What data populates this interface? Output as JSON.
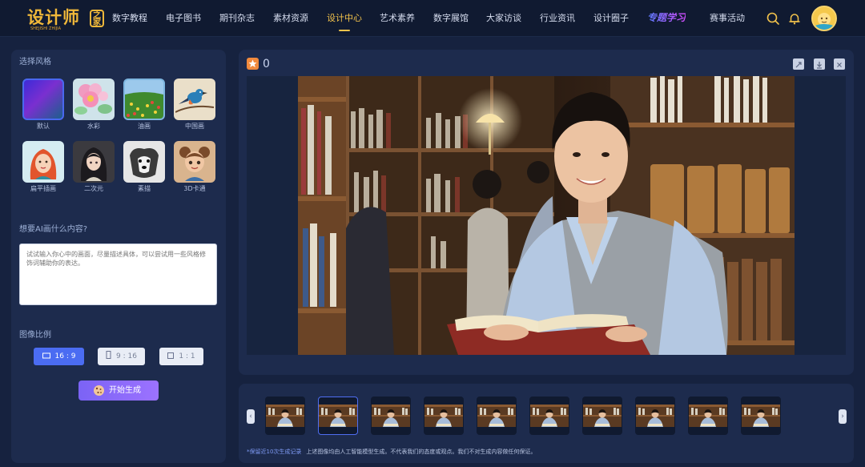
{
  "logo": {
    "text": "设计师",
    "badge": "之家",
    "sub": "SHEJISHI ZHIJIA"
  },
  "nav": {
    "items": [
      {
        "label": "数字教程"
      },
      {
        "label": "电子图书"
      },
      {
        "label": "期刊杂志"
      },
      {
        "label": "素材资源"
      },
      {
        "label": "设计中心",
        "active": true
      },
      {
        "label": "艺术素养"
      },
      {
        "label": "数字展馆"
      },
      {
        "label": "大家访谈"
      },
      {
        "label": "行业资讯"
      },
      {
        "label": "设计圈子"
      },
      {
        "label": "专题学习",
        "special": true
      },
      {
        "label": "赛事活动"
      }
    ],
    "icons": [
      "search-icon",
      "bell-icon"
    ],
    "accent": "#f3c34c"
  },
  "sidebar": {
    "style_title": "选择风格",
    "styles": [
      {
        "label": "默认",
        "selected": true
      },
      {
        "label": "水彩"
      },
      {
        "label": "油画"
      },
      {
        "label": "中国画"
      },
      {
        "label": "扁平插画"
      },
      {
        "label": "二次元"
      },
      {
        "label": "素描"
      },
      {
        "label": "3D卡通"
      }
    ],
    "prompt_title": "想要AI画什么内容?",
    "prompt_placeholder": "试试输入你心中的画面，尽量描述具体，可以尝试用一些风格修饰词辅助你的表达。",
    "ratio_title": "图像比例",
    "ratios": [
      {
        "label": "16 : 9",
        "active": true
      },
      {
        "label": "9 : 16"
      },
      {
        "label": "1 : 1"
      }
    ],
    "generate_label": "开始生成",
    "button_color": "#8a6bf8"
  },
  "main": {
    "favorite_count": "0",
    "tools": [
      "expand-icon",
      "download-icon",
      "close-icon"
    ]
  },
  "history": {
    "thumb_count": 10,
    "selected_index": 1,
    "note_left": "*保留近10次生成记录",
    "note_right": "上述图像均由人工智能模型生成。不代表我们的态度或观点。我们不对生成内容做任何保证。"
  }
}
